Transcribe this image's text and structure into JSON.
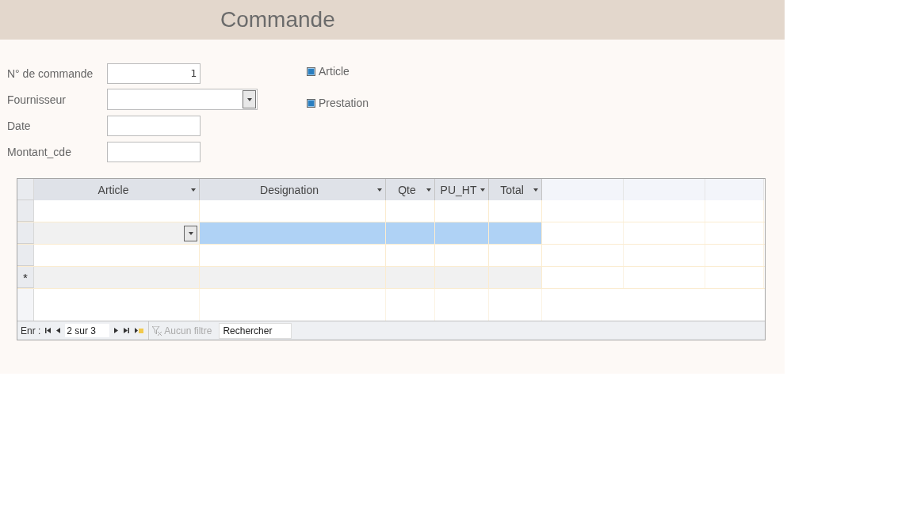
{
  "title": "Commande",
  "fields": [
    {
      "label": "N° de commande",
      "value": "1",
      "kind": "text"
    },
    {
      "label": "Fournisseur",
      "kind": "combo"
    },
    {
      "label": "Date",
      "kind": "text"
    },
    {
      "label": "Montant_cde",
      "kind": "text"
    }
  ],
  "options": [
    {
      "label": "Article",
      "checked": true
    },
    {
      "label": "Prestation",
      "checked": true
    }
  ],
  "subform": {
    "columns": [
      "Article",
      "Designation",
      "Qte",
      "PU_HT",
      "Total"
    ],
    "rows": [
      {
        "kind": "record",
        "selected": false
      },
      {
        "kind": "record",
        "selected": true
      },
      {
        "kind": "record",
        "selected": false
      },
      {
        "kind": "new",
        "marker": "*",
        "selected": false
      }
    ],
    "nav": {
      "label": "Enr :",
      "position": "2 sur 3",
      "filter": "Aucun filtre",
      "filter_disabled": true,
      "search_placeholder": "Rechercher"
    }
  }
}
